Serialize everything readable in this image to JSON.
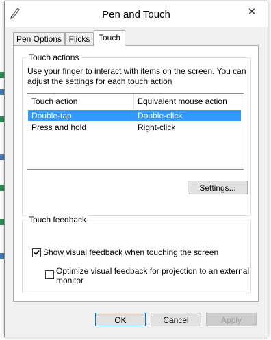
{
  "window": {
    "title": "Pen and Touch",
    "close_glyph": "✕"
  },
  "tabs": [
    {
      "label": "Pen Options",
      "active": false
    },
    {
      "label": "Flicks",
      "active": false
    },
    {
      "label": "Touch",
      "active": true
    }
  ],
  "touch_actions": {
    "group_label": "Touch actions",
    "description": "Use your finger to interact with items on the screen. You can adjust the settings for each touch action",
    "columns": [
      "Touch action",
      "Equivalent mouse action"
    ],
    "rows": [
      {
        "action": "Double-tap",
        "mouse": "Double-click",
        "selected": true
      },
      {
        "action": "Press and hold",
        "mouse": "Right-click",
        "selected": false
      }
    ],
    "settings_button": "Settings..."
  },
  "touch_feedback": {
    "group_label": "Touch feedback",
    "show_visual_feedback": {
      "label": "Show visual feedback when touching the screen",
      "checked": true
    },
    "optimize_feedback": {
      "label_line1": "Optimize visual feedback for projection to an external",
      "label_line2": "monitor",
      "checked": false
    }
  },
  "buttons": {
    "ok": "OK",
    "cancel": "Cancel",
    "apply": "Apply"
  },
  "colors": {
    "selection": "#3399ff",
    "accent": "#0078d7"
  },
  "icons": {
    "app": "pen-icon",
    "close": "close-icon",
    "check": "checkmark-icon"
  }
}
